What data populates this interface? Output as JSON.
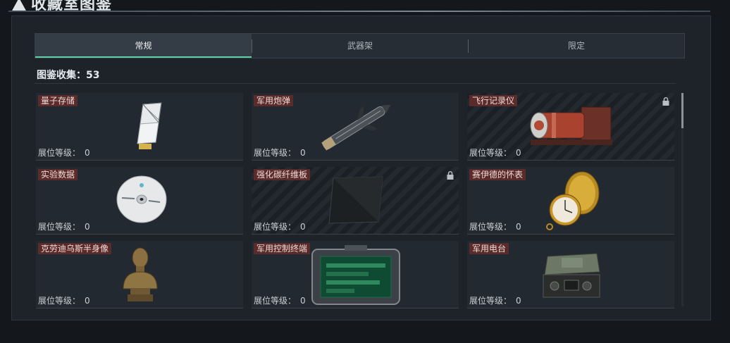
{
  "header": {
    "title": "收藏室图鉴"
  },
  "tabs": [
    {
      "label": "常规",
      "active": true
    },
    {
      "label": "武器架",
      "active": false
    },
    {
      "label": "限定",
      "active": false
    }
  ],
  "collection": {
    "label": "图鉴收集：",
    "count": "53"
  },
  "level_label": "展位等级：",
  "items": [
    {
      "name": "量子存储",
      "level": "0",
      "locked": false,
      "icon": "quantum-storage-icon"
    },
    {
      "name": "军用炮弹",
      "level": "0",
      "locked": false,
      "icon": "artillery-shell-icon"
    },
    {
      "name": "飞行记录仪",
      "level": "0",
      "locked": true,
      "icon": "flight-recorder-icon"
    },
    {
      "name": "实验数据",
      "level": "0",
      "locked": false,
      "icon": "data-disc-icon"
    },
    {
      "name": "强化碳纤维板",
      "level": "0",
      "locked": true,
      "icon": "carbon-plate-icon"
    },
    {
      "name": "赛伊德的怀表",
      "level": "0",
      "locked": false,
      "icon": "pocket-watch-icon"
    },
    {
      "name": "克劳迪乌斯半身像",
      "level": "0",
      "locked": false,
      "icon": "bust-icon"
    },
    {
      "name": "军用控制终端",
      "level": "0",
      "locked": false,
      "icon": "control-terminal-icon"
    },
    {
      "name": "军用电台",
      "level": "0",
      "locked": false,
      "icon": "radio-icon"
    }
  ],
  "colors": {
    "accent": "#5fcfa6",
    "tag_bg": "#5a2b2b"
  }
}
